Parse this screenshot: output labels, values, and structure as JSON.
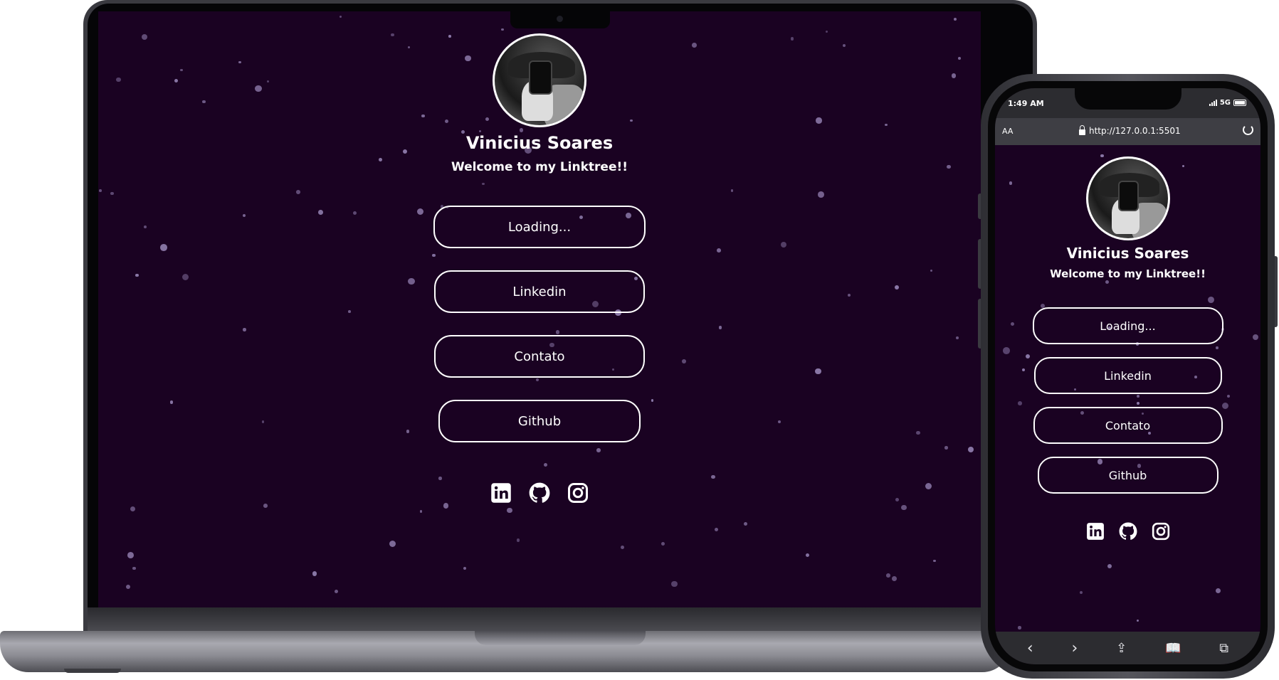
{
  "profile": {
    "name": "Vinicius Soares",
    "welcome": "Welcome to my Linktree!!"
  },
  "links": [
    {
      "label": "Loading..."
    },
    {
      "label": "Linkedin"
    },
    {
      "label": "Contato"
    },
    {
      "label": "Github"
    }
  ],
  "socials": [
    "linkedin-icon",
    "github-icon",
    "instagram-icon"
  ],
  "phone": {
    "time": "1:49 AM",
    "network": "5G",
    "url_prefix": "AA",
    "url": "http://127.0.0.1:5501"
  },
  "colors": {
    "background": "#1a0222",
    "star": "#8b78a8",
    "text": "#ffffff"
  }
}
